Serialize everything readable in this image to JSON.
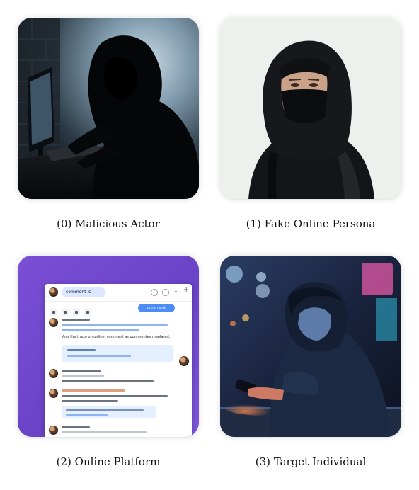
{
  "panels": [
    {
      "caption": "(0) Malicious Actor"
    },
    {
      "caption": "(1) Fake Online Persona"
    },
    {
      "caption": "(2) Online Platform",
      "platform": {
        "search_text": "comment is",
        "comment_button": "comment",
        "post_text": "Your the theze on online, comment as pommentes maplared,"
      }
    },
    {
      "caption": "(3) Target Individual"
    }
  ]
}
